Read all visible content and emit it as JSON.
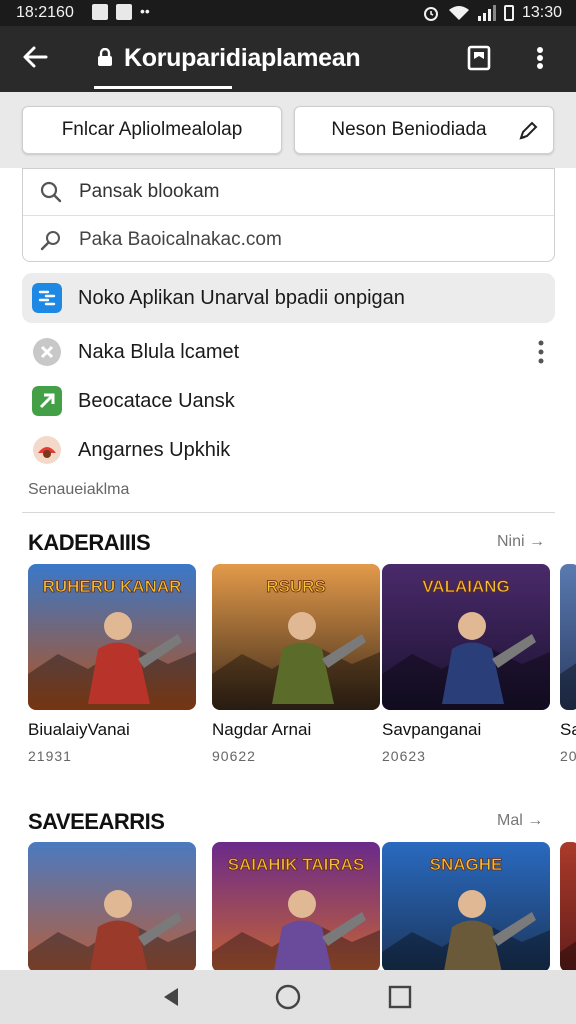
{
  "status_bar": {
    "time": "18:21",
    "time_suffix": "60",
    "clock_right": "13:30"
  },
  "app_bar": {
    "title": "Koruparidiaplamean"
  },
  "tabs": [
    {
      "label": "Fnlcar Apliolmealolap"
    },
    {
      "label": "Neson Beniodiada"
    }
  ],
  "search": {
    "query_label": "Pansak blookam",
    "url_label": "Paka Baoicalnakac.com"
  },
  "list_items": [
    {
      "label": "Noko Aplikan Unarval bpadii onpigan",
      "color": "#1e88e5"
    },
    {
      "label": "Naka Blula lcamet",
      "color": "#9e9e9e"
    },
    {
      "label": "Beocatace Uansk",
      "color": "#43a047"
    },
    {
      "label": "Angarnes Upkhik",
      "color": "#e53935"
    }
  ],
  "section_tag": "Senaueiaklma",
  "sections": [
    {
      "title": "KADERAIIIS",
      "more_label": "Nini",
      "cards": [
        {
          "title": "BiualaiyVanai",
          "year": "21931",
          "art_text": "RUHERU KANAR",
          "bg_top": "#3a78c9",
          "bg_bottom": "#b5521a",
          "hero": "#b8342a"
        },
        {
          "title": "Nagdar Arnai",
          "year": "90622",
          "art_text": "RSURS",
          "bg_top": "#e39a4a",
          "bg_bottom": "#3d2a1a",
          "hero": "#5b6b2a"
        },
        {
          "title": "Savpanganai",
          "year": "20623",
          "art_text": "VALAIANG",
          "bg_top": "#4a2a6a",
          "bg_bottom": "#1a1230",
          "hero": "#2a3f7a"
        },
        {
          "title": "Sa",
          "year": "20",
          "art_text": "",
          "bg_top": "#5a7ab0",
          "bg_bottom": "#2a3a60",
          "hero": "#3a4a80"
        }
      ]
    },
    {
      "title": "SAVEEARRIS",
      "more_label": "Mal",
      "cards": [
        {
          "title": "",
          "year": "",
          "art_text": "",
          "bg_top": "#4a7ac0",
          "bg_bottom": "#c45a2a",
          "hero": "#9a3a2a"
        },
        {
          "title": "",
          "year": "",
          "art_text": "SAIAHIK TAIRAS",
          "bg_top": "#6a2a8a",
          "bg_bottom": "#d06a2a",
          "hero": "#6a4a9a"
        },
        {
          "title": "",
          "year": "",
          "art_text": "SNAGHE",
          "bg_top": "#2a6ac0",
          "bg_bottom": "#1a3050",
          "hero": "#6a5a3a"
        },
        {
          "title": "",
          "year": "",
          "art_text": "",
          "bg_top": "#aa3a2a",
          "bg_bottom": "#5a1a1a",
          "hero": "#7a2a2a"
        }
      ]
    }
  ]
}
